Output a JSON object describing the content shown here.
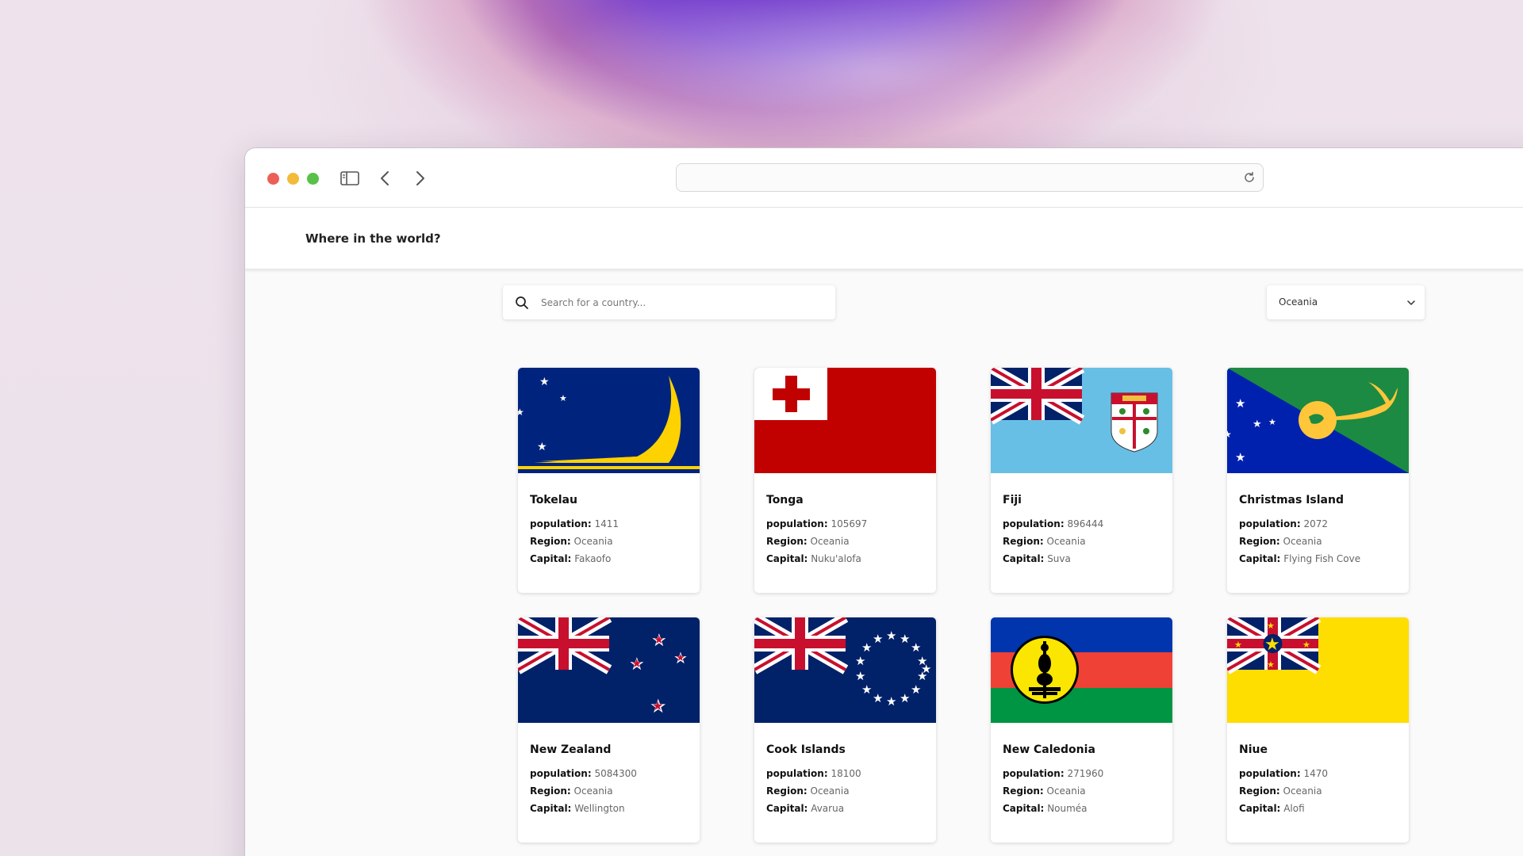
{
  "browser": {
    "address_value": "",
    "buttons": {
      "close_color": "#ec5f57",
      "minimize_color": "#f2bc3a",
      "maximize_color": "#59c149"
    }
  },
  "app": {
    "title": "Where in the world?",
    "search": {
      "placeholder": "Search for a country...",
      "value": ""
    },
    "region_filter": {
      "selected": "Oceania"
    }
  },
  "labels": {
    "population": "population:",
    "region": "Region:",
    "capital": "Capital:"
  },
  "countries": [
    {
      "name": "Tokelau",
      "population": "1411",
      "region": "Oceania",
      "capital": "Fakaofo",
      "flag_icon": "tokelau-flag"
    },
    {
      "name": "Tonga",
      "population": "105697",
      "region": "Oceania",
      "capital": "Nuku'alofa",
      "flag_icon": "tonga-flag"
    },
    {
      "name": "Fiji",
      "population": "896444",
      "region": "Oceania",
      "capital": "Suva",
      "flag_icon": "fiji-flag"
    },
    {
      "name": "Christmas Island",
      "population": "2072",
      "region": "Oceania",
      "capital": "Flying Fish Cove",
      "flag_icon": "christmas-island-flag"
    },
    {
      "name": "New Zealand",
      "population": "5084300",
      "region": "Oceania",
      "capital": "Wellington",
      "flag_icon": "new-zealand-flag"
    },
    {
      "name": "Cook Islands",
      "population": "18100",
      "region": "Oceania",
      "capital": "Avarua",
      "flag_icon": "cook-islands-flag"
    },
    {
      "name": "New Caledonia",
      "population": "271960",
      "region": "Oceania",
      "capital": "Nouméa",
      "flag_icon": "new-caledonia-flag"
    },
    {
      "name": "Niue",
      "population": "1470",
      "region": "Oceania",
      "capital": "Alofi",
      "flag_icon": "niue-flag"
    }
  ]
}
